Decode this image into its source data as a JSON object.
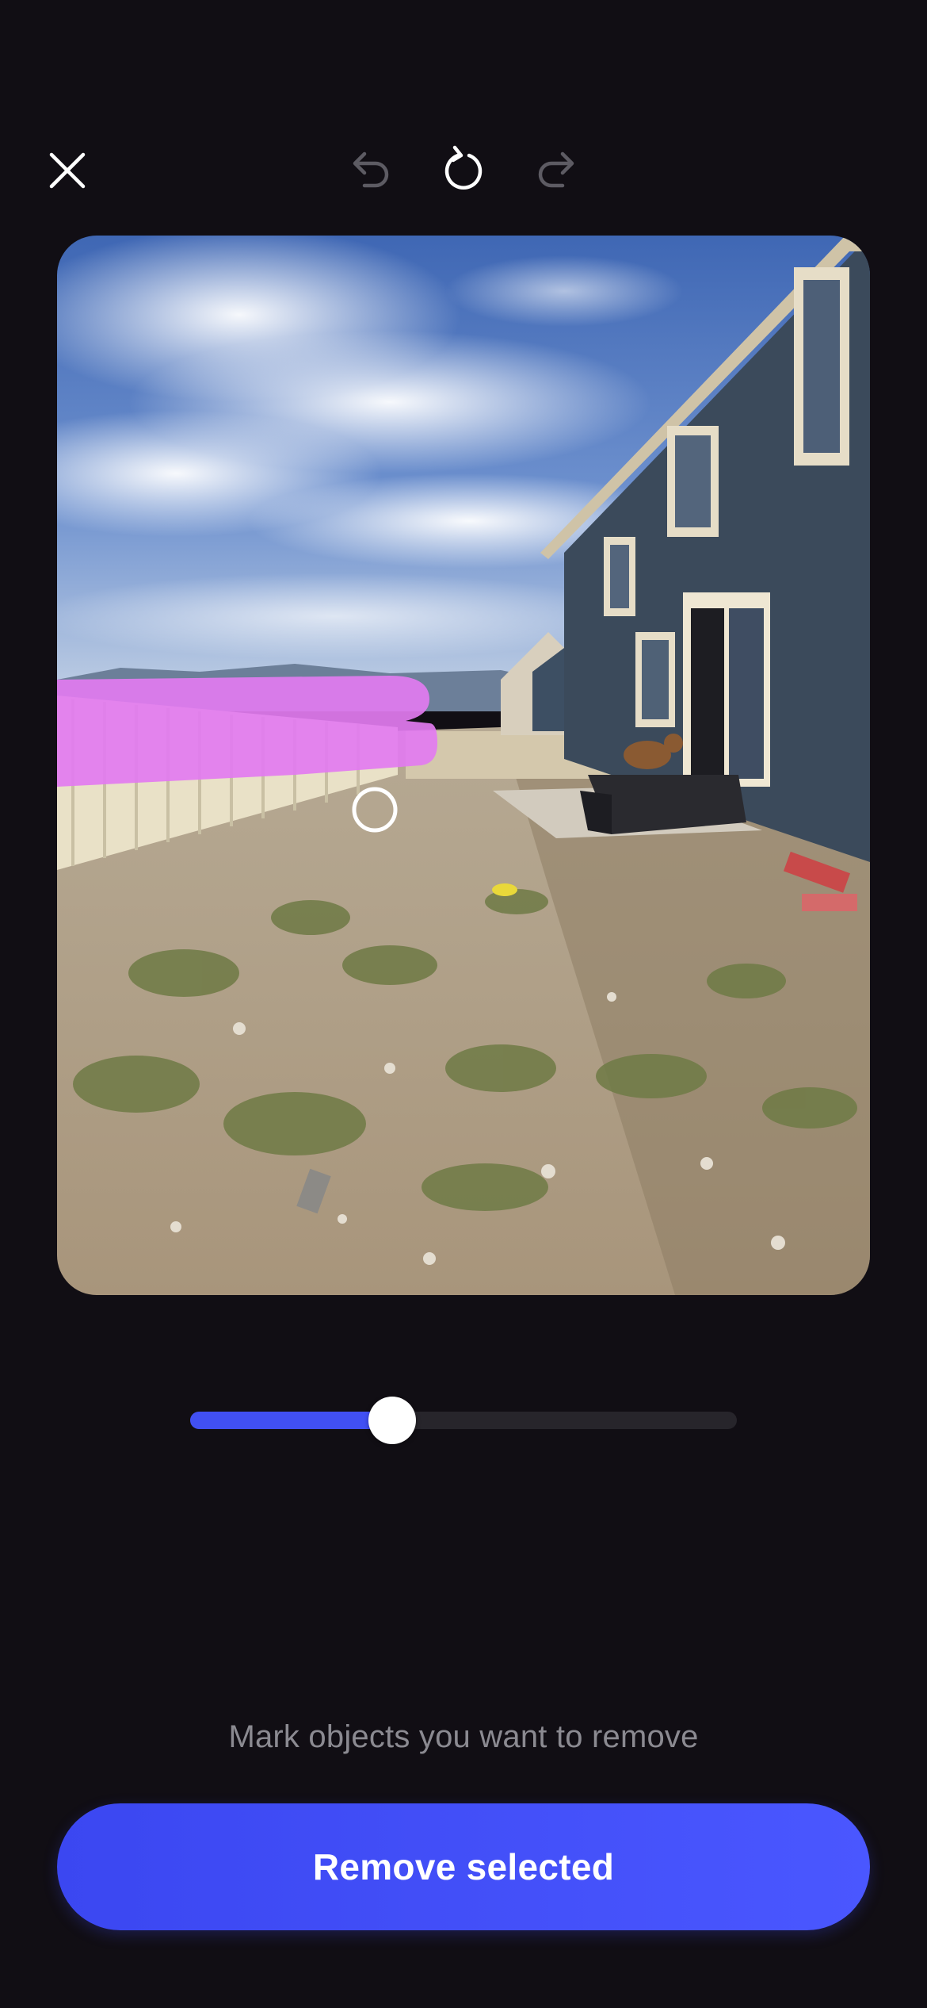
{
  "toolbar": {
    "close_icon": "close-icon",
    "undo_icon": "undo-icon",
    "reset_icon": "reset-icon",
    "redo_icon": "redo-icon",
    "undo_enabled": false,
    "redo_enabled": false
  },
  "photo": {
    "description_icon": "photo-backyard",
    "mask_color": "#e27bf0"
  },
  "brush_slider": {
    "value": 0.37
  },
  "hint_text": "Mark objects you want to remove",
  "primary_button": {
    "label": "Remove selected",
    "color": "#4150f3"
  }
}
